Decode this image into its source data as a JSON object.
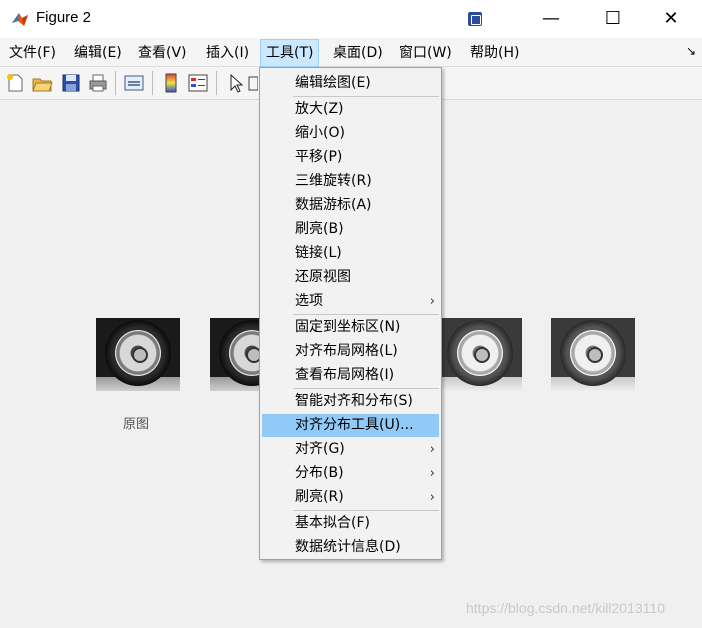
{
  "window": {
    "title": "Figure 2",
    "controls": {
      "minimize": "—",
      "maximize": "☐",
      "close": "✕"
    }
  },
  "menubar": {
    "items": [
      {
        "label": "文件(F)"
      },
      {
        "label": "编辑(E)"
      },
      {
        "label": "查看(V)"
      },
      {
        "label": "插入(I)"
      },
      {
        "label": "工具(T)",
        "active": true
      },
      {
        "label": "桌面(D)"
      },
      {
        "label": "窗口(W)"
      },
      {
        "label": "帮助(H)"
      }
    ],
    "overflow_icon": "dock-arrow-icon"
  },
  "toolbar": {
    "icons": [
      "new-figure-icon",
      "open-file-icon",
      "save-icon",
      "print-icon",
      "link-plot-icon",
      "colorbar-icon",
      "legend-icon",
      "select-pointer-icon"
    ]
  },
  "tools_menu": {
    "items": [
      {
        "label": "编辑绘图(E)"
      },
      {
        "label": "放大(Z)"
      },
      {
        "label": "缩小(O)"
      },
      {
        "label": "平移(P)"
      },
      {
        "label": "三维旋转(R)"
      },
      {
        "label": "数据游标(A)"
      },
      {
        "label": "刷亮(B)"
      },
      {
        "label": "链接(L)"
      },
      {
        "label": "还原视图"
      },
      {
        "label": "选项",
        "submenu": true
      },
      {
        "label": "固定到坐标区(N)"
      },
      {
        "label": "对齐布局网格(L)"
      },
      {
        "label": "查看布局网格(I)"
      },
      {
        "label": "智能对齐和分布(S)"
      },
      {
        "label": "对齐分布工具(U)...",
        "highlighted": true
      },
      {
        "label": "对齐(G)",
        "submenu": true
      },
      {
        "label": "分布(B)",
        "submenu": true
      },
      {
        "label": "刷亮(R)",
        "submenu": true
      },
      {
        "label": "基本拟合(F)"
      },
      {
        "label": "数据统计信息(D)"
      }
    ],
    "submenu_arrow": "›"
  },
  "figure": {
    "caption": "原图"
  },
  "watermark": "https://blog.csdn.net/kill2013110",
  "colors": {
    "menu_highlight": "#91c9f7",
    "menubar_active": "#cce8ff"
  }
}
